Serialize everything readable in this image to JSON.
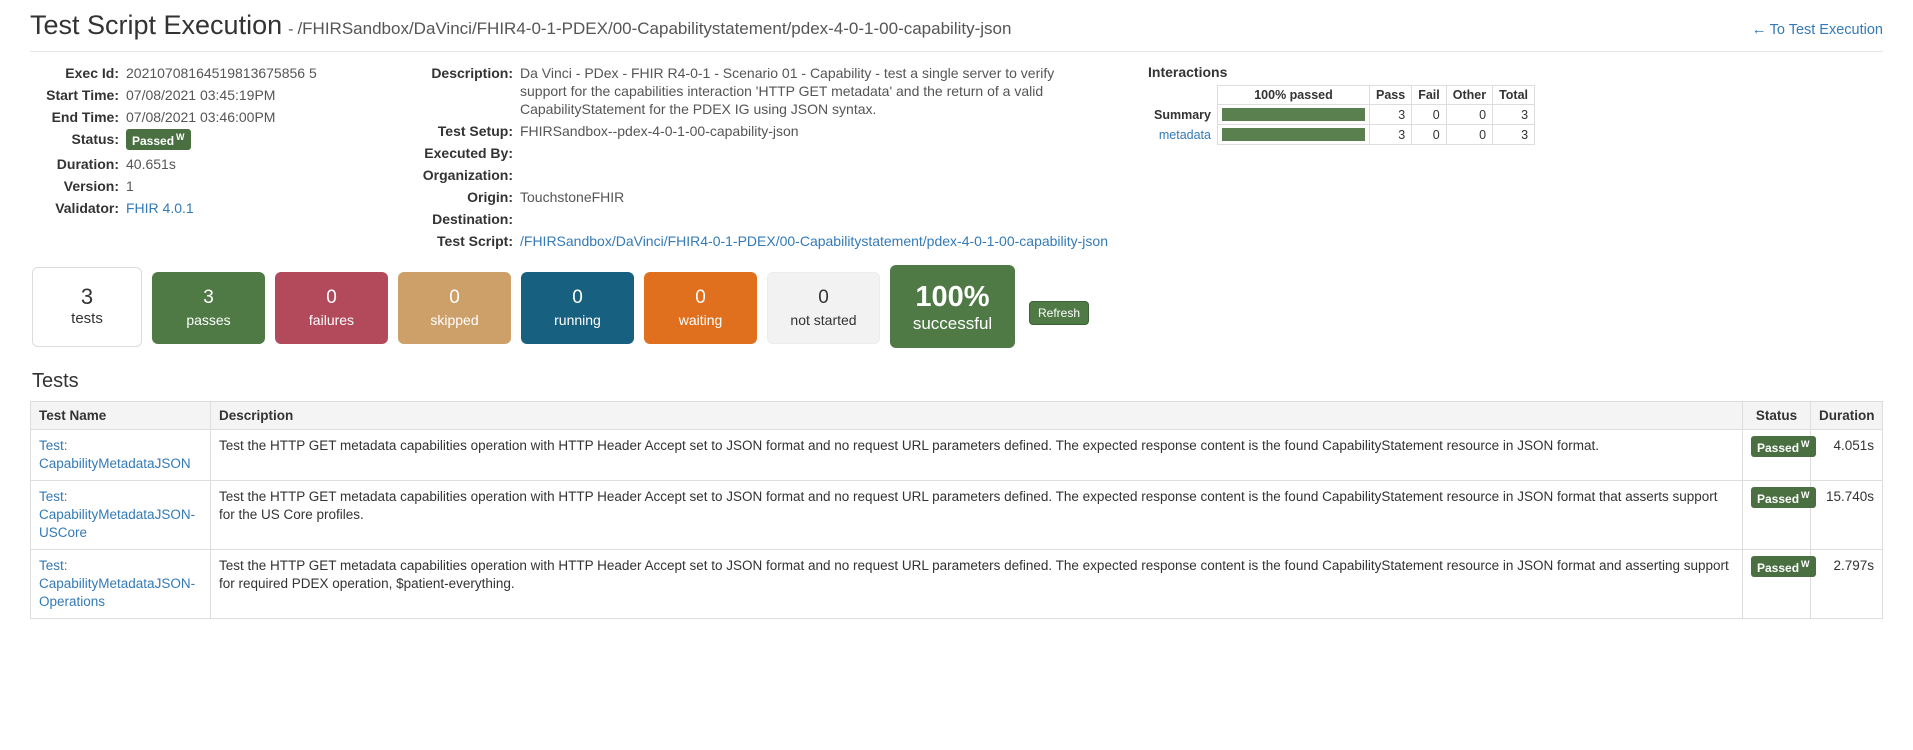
{
  "header": {
    "title": "Test Script Execution",
    "separator": "-",
    "subtitle": "/FHIRSandbox/DaVinci/FHIR4-0-1-PDEX/00-Capabilitystatement/pdex-4-0-1-00-capability-json",
    "back_link": "To Test Execution",
    "back_arrow": "←"
  },
  "details_left": [
    {
      "label": "Exec Id:",
      "value": "20210708164519813675856 5"
    },
    {
      "label": "Start Time:",
      "value": "07/08/2021 03:45:19PM"
    },
    {
      "label": "End Time:",
      "value": "07/08/2021 03:46:00PM"
    },
    {
      "label": "Status:",
      "value": "Passed",
      "badge": true,
      "badge_sup": "W"
    },
    {
      "label": "Duration:",
      "value": "40.651s"
    },
    {
      "label": "Version:",
      "value": "1"
    },
    {
      "label": "Validator:",
      "value": "FHIR 4.0.1",
      "link": true
    }
  ],
  "details_mid": [
    {
      "label": "Description:",
      "value": "Da Vinci - PDex - FHIR R4-0-1 - Scenario 01 - Capability - test a single server to verify support for the capabilities interaction 'HTTP GET metadata' and the return of a valid CapabilityStatement for the PDEX IG using JSON syntax."
    },
    {
      "label": "Test Setup:",
      "value": "FHIRSandbox--pdex-4-0-1-00-capability-json"
    },
    {
      "label": "Executed By:",
      "value": ""
    },
    {
      "label": "Organization:",
      "value": ""
    },
    {
      "label": "Origin:",
      "value": "TouchstoneFHIR"
    },
    {
      "label": "Destination:",
      "value": ""
    },
    {
      "label": "Test Script:",
      "value": "/FHIRSandbox/DaVinci/FHIR4-0-1-PDEX/00-Capabilitystatement/pdex-4-0-1-00-capability-json",
      "link": true
    }
  ],
  "interactions": {
    "title": "Interactions",
    "columns": [
      "",
      "100% passed",
      "Pass",
      "Fail",
      "Other",
      "Total"
    ],
    "rows": [
      {
        "name": "Summary",
        "link": false,
        "percent": 100,
        "pass": "3",
        "fail": "0",
        "other": "0",
        "total": "3"
      },
      {
        "name": "metadata",
        "link": true,
        "percent": 100,
        "pass": "3",
        "fail": "0",
        "other": "0",
        "total": "3"
      }
    ]
  },
  "stats": [
    {
      "key": "tests",
      "number": "3",
      "label": "tests"
    },
    {
      "key": "passes",
      "number": "3",
      "label": "passes"
    },
    {
      "key": "failures",
      "number": "0",
      "label": "failures"
    },
    {
      "key": "skipped",
      "number": "0",
      "label": "skipped"
    },
    {
      "key": "running",
      "number": "0",
      "label": "running"
    },
    {
      "key": "waiting",
      "number": "0",
      "label": "waiting"
    },
    {
      "key": "notstarted",
      "number": "0",
      "label": "not started"
    },
    {
      "key": "successful",
      "number": "100%",
      "label": "successful"
    }
  ],
  "refresh_label": "Refresh",
  "tests_section": {
    "heading": "Tests",
    "columns": {
      "name": "Test Name",
      "description": "Description",
      "status": "Status",
      "duration": "Duration"
    },
    "rows": [
      {
        "prefix": "Test:",
        "name": "CapabilityMetadataJSON",
        "description": "Test the HTTP GET metadata capabilities operation with HTTP Header Accept set to JSON format and no request URL parameters defined. The expected response content is the found CapabilityStatement resource in JSON format.",
        "status": "Passed",
        "status_sup": "W",
        "duration": "4.051s"
      },
      {
        "prefix": "Test:",
        "name": "CapabilityMetadataJSON-USCore",
        "description": "Test the HTTP GET metadata capabilities operation with HTTP Header Accept set to JSON format and no request URL parameters defined. The expected response content is the found CapabilityStatement resource in JSON format that asserts support for the US Core profiles.",
        "status": "Passed",
        "status_sup": "W",
        "duration": "15.740s"
      },
      {
        "prefix": "Test:",
        "name": "CapabilityMetadataJSON-Operations",
        "description": "Test the HTTP GET metadata capabilities operation with HTTP Header Accept set to JSON format and no request URL parameters defined. The expected response content is the found CapabilityStatement resource in JSON format and asserting support for required PDEX operation, $patient-everything.",
        "status": "Passed",
        "status_sup": "W",
        "duration": "2.797s"
      }
    ]
  },
  "colors": {
    "green": "#4f7a46",
    "red": "#b24a5b",
    "tan": "#cda06a",
    "blue": "#17607f",
    "orange": "#e0701d",
    "gray": "#f2f2f2",
    "link": "#337ab7"
  }
}
